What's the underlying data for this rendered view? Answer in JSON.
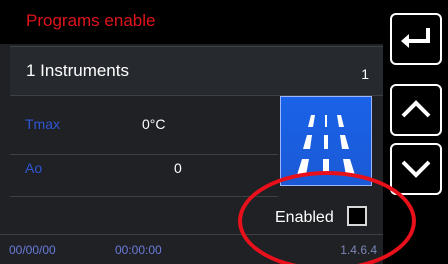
{
  "window": {
    "title": "Programs enable"
  },
  "instrument": {
    "name": "1 Instruments",
    "count": "1"
  },
  "params": [
    {
      "label": "Tmax",
      "value": "0°C"
    },
    {
      "label": "Ao",
      "value": "0"
    }
  ],
  "program_icon": "road-lanes-icon",
  "enabled": {
    "label": "Enabled",
    "checked": false
  },
  "status": {
    "date": "00/00/00",
    "time": "00:00:00",
    "version": "1.4.6.4"
  },
  "nav": {
    "back_icon": "back-arrow-icon",
    "up_icon": "chevron-up-icon",
    "down_icon": "chevron-down-icon"
  },
  "colors": {
    "title": "#e0141b",
    "label": "#2f56d6",
    "tile": "#1a62e8",
    "annotation": "#e8101a"
  }
}
